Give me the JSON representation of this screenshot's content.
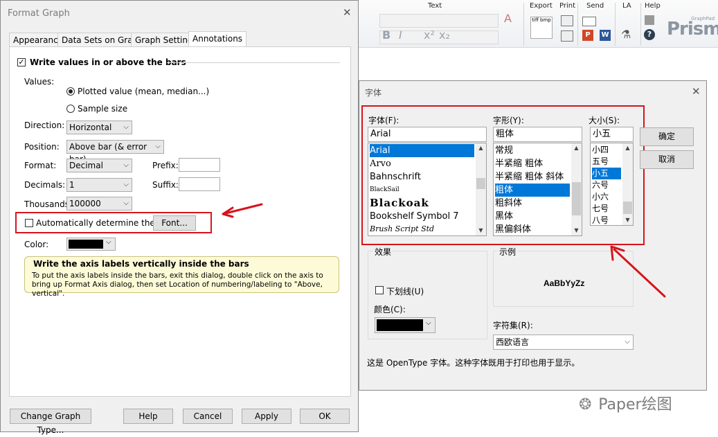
{
  "ribbon": {
    "text_group": "Text",
    "export_label": "Export",
    "print_label": "Print",
    "send_label": "Send",
    "la_label": "LA",
    "help_label": "Help",
    "tiff_label": "tiff bmp",
    "logo": "Prism",
    "logo_small": "GraphPad",
    "p_icon": "P",
    "w_icon": "W",
    "font_a": "A",
    "bold": "B",
    "italic": "I",
    "x2": "x²",
    "x_sub": "x₂"
  },
  "format_graph": {
    "title": "Format Graph",
    "tabs": [
      "Appearance",
      "Data Sets on Graph",
      "Graph Settings",
      "Annotations"
    ],
    "active_tab": "Annotations",
    "write_values_label": "Write values in or above the bars",
    "values_label": "Values:",
    "radio_plotted": "Plotted value (mean, median...)",
    "radio_sample": "Sample size",
    "direction_label": "Direction:",
    "direction_value": "Horizontal",
    "position_label": "Position:",
    "position_value": "Above bar (& error bar)",
    "format_label": "Format:",
    "format_value": "Decimal",
    "prefix_label": "Prefix:",
    "decimals_label": "Decimals:",
    "decimals_value": "1",
    "suffix_label": "Suffix:",
    "thousands_label": "Thousands:",
    "thousands_value": "100000",
    "auto_font_label": "Automatically determine the font",
    "font_button": "Font...",
    "color_label": "Color:",
    "color_value": "#000000",
    "tip_title": "Write the axis labels vertically inside the bars",
    "tip_body": "To put the axis labels inside the bars, exit this dialog, double click on the axis to bring up Format Axis dialog, then set Location of numbering/labeling to \"Above, vertical\".",
    "buttons": {
      "change_graph_type": "Change Graph Type...",
      "help": "Help",
      "cancel": "Cancel",
      "apply": "Apply",
      "ok": "OK"
    }
  },
  "font_dialog": {
    "title": "字体",
    "font_label": "字体(F):",
    "font_value": "Arial",
    "fonts": [
      "Arial",
      "Arvo",
      "Bahnschrift",
      "BlackSail",
      "Blackoak",
      "Bookshelf Symbol 7",
      "Brush Script Std"
    ],
    "style_label": "字形(Y):",
    "style_value": "粗体",
    "styles": [
      "常规",
      "半紧缩 粗体",
      "半紧缩 粗体 斜体",
      "粗体",
      "粗斜体",
      "黑体",
      "黑偏斜体"
    ],
    "size_label": "大小(S):",
    "size_value": "小五",
    "sizes": [
      "小四",
      "五号",
      "小五",
      "六号",
      "小六",
      "七号",
      "八号"
    ],
    "ok": "确定",
    "cancel": "取消",
    "effects_label": "效果",
    "underline_label": "下划线(U)",
    "color_label": "颜色(C):",
    "color_value": "#000000",
    "sample_label": "示例",
    "sample_text": "AaBbYyZz",
    "charset_label": "字符集(R):",
    "charset_value": "西欧语言",
    "description": "这是 OpenType 字体。这种字体既用于打印也用于显示。"
  },
  "accent_color": "#d7141a",
  "watermark": "Paper绘图",
  "icons": [
    "checkbox-checked-icon",
    "radio-icon",
    "dropdown-arrow-icon",
    "close-icon",
    "wechat-icon",
    "red-arrow-icon"
  ]
}
